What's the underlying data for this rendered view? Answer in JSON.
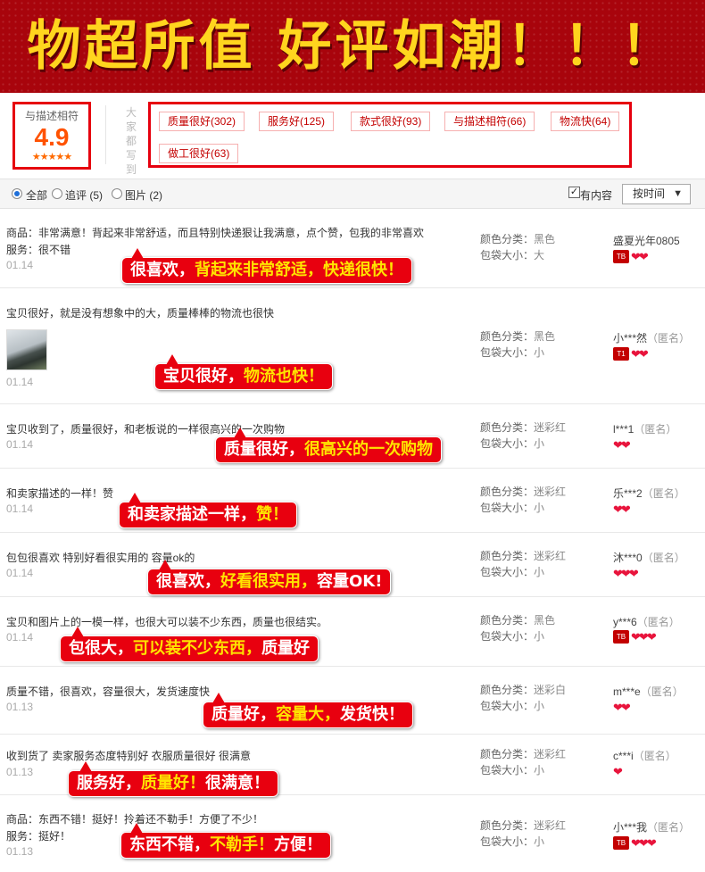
{
  "banner": {
    "text": "物超所值 好评如潮！！！"
  },
  "summary": {
    "score_label": "与描述相符",
    "score": "4.9",
    "stars": "★★★★★",
    "impressions_label": "大家都写到",
    "tags": [
      "质量很好(302)",
      "服务好(125)",
      "款式很好(93)",
      "与描述相符(66)",
      "物流快(64)",
      "做工很好(63)"
    ]
  },
  "filter": {
    "all_label": "全部",
    "append_label": "追评 (5)",
    "photo_label": "图片 (2)",
    "has_content_label": "有内容",
    "sort_label": "按时间",
    "checkbox_mark": "✓",
    "arrow": "▼"
  },
  "sku_labels": {
    "color": "颜色分类：",
    "size": "包袋大小："
  },
  "badges": {
    "tm": "TB",
    "t1": "T1",
    "heart": "❤"
  },
  "reviews": [
    {
      "line1": "商品：非常满意！背起来非常舒适，而且特别快递狠让我满意，点个赞，包我的非常喜欢",
      "line2": "服务：很不错",
      "date": "01.14",
      "color": "黑色",
      "size": "大",
      "user": "盛夏光年0805",
      "anon": "",
      "callout_a": "很喜欢，",
      "callout_b": "背起来非常舒适，快递很快！",
      "callout_c": ""
    },
    {
      "line1": "宝贝很好，就是没有想象中的大，质量棒棒的物流也很快",
      "line2": "",
      "date": "01.14",
      "color": "黑色",
      "size": "小",
      "user": "小***然",
      "anon": "（匿名）",
      "callout_a": "宝贝很好，",
      "callout_b": "物流也快！",
      "callout_c": ""
    },
    {
      "line1": "宝贝收到了，质量很好，和老板说的一样很高兴的一次购物",
      "line2": "",
      "date": "01.14",
      "color": "迷彩红",
      "size": "小",
      "user": "l***1",
      "anon": "（匿名）",
      "callout_a": "质量很好，",
      "callout_b": "很高兴的一次购物",
      "callout_c": ""
    },
    {
      "line1": "和卖家描述的一样！赞",
      "line2": "",
      "date": "01.14",
      "color": "迷彩红",
      "size": "小",
      "user": "乐***2",
      "anon": "（匿名）",
      "callout_a": "和卖家描述一样，",
      "callout_b": "赞！",
      "callout_c": ""
    },
    {
      "line1": "包包很喜欢 特别好看很实用的 容量ok的",
      "line2": "",
      "date": "01.14",
      "color": "迷彩红",
      "size": "小",
      "user": "沐***0",
      "anon": "（匿名）",
      "callout_a": "很喜欢，",
      "callout_b": "好看很实用，",
      "callout_c": "容量OK!"
    },
    {
      "line1": "宝贝和图片上的一模一样，也很大可以装不少东西，质量也很结实。",
      "line2": "",
      "date": "01.14",
      "color": "黑色",
      "size": "小",
      "user": "y***6",
      "anon": "（匿名）",
      "callout_a": "包很大，",
      "callout_b": "可以装不少东西，",
      "callout_c": "质量好"
    },
    {
      "line1": "质量不错，很喜欢，容量很大，发货速度快",
      "line2": "",
      "date": "01.13",
      "color": "迷彩白",
      "size": "小",
      "user": "m***e",
      "anon": "（匿名）",
      "callout_a": "质量好，",
      "callout_b": "容量大，",
      "callout_c": "发货快！"
    },
    {
      "line1": "收到货了 卖家服务态度特别好 衣服质量很好 很满意",
      "line2": "",
      "date": "01.13",
      "color": "迷彩红",
      "size": "小",
      "user": "c***i",
      "anon": "（匿名）",
      "callout_a": "服务好，",
      "callout_b": "质量好！",
      "callout_c": "很满意！"
    },
    {
      "line1": "商品：东西不错！挺好！拎着还不勒手！方便了不少！",
      "line2": "服务：挺好！",
      "date": "01.13",
      "color": "迷彩红",
      "size": "小",
      "user": "小***我",
      "anon": "（匿名）",
      "callout_a": "东西不错，",
      "callout_b": "不勒手！",
      "callout_c": "方便！"
    }
  ]
}
